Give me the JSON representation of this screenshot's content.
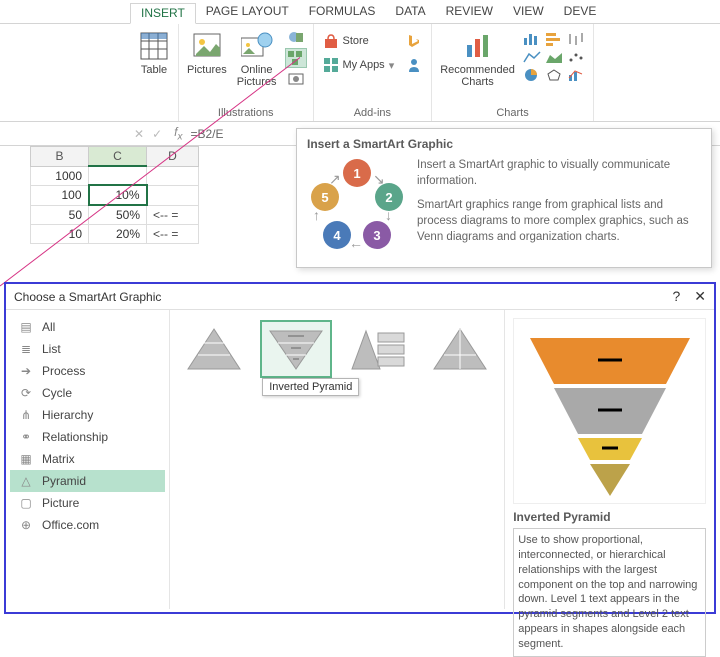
{
  "ribbon": {
    "tabs": [
      "INSERT",
      "PAGE LAYOUT",
      "FORMULAS",
      "DATA",
      "REVIEW",
      "VIEW",
      "DEVE"
    ],
    "active_tab": "INSERT",
    "tables": {
      "table_label": "Table",
      "group_label": ""
    },
    "illustrations": {
      "pictures_label": "Pictures",
      "online_pictures_label": "Online\nPictures",
      "group_label": "Illustrations"
    },
    "addins": {
      "store_label": "Store",
      "myapps_label": "My Apps",
      "group_label": "Add-ins"
    },
    "charts": {
      "recommended_label": "Recommended\nCharts",
      "group_label": "Charts"
    }
  },
  "formula_bar": {
    "formula": "=B2/E"
  },
  "sheet": {
    "cols": [
      "B",
      "C",
      "D"
    ],
    "selected_col": "C",
    "rows": [
      {
        "b": "1000",
        "c": "",
        "d": ""
      },
      {
        "b": "100",
        "c": "10%",
        "d": "",
        "selected": true
      },
      {
        "b": "50",
        "c": "50%",
        "d": "<--  ="
      },
      {
        "b": "10",
        "c": "20%",
        "d": "<--  ="
      }
    ]
  },
  "smartart_tip": {
    "title": "Insert a SmartArt Graphic",
    "p1": "Insert a SmartArt graphic to visually communicate information.",
    "p2": "SmartArt graphics range from graphical lists and process diagrams to more complex graphics, such as Venn diagrams and organization charts."
  },
  "dialog": {
    "title": "Choose a SmartArt Graphic",
    "help": "?",
    "close": "✕",
    "categories": [
      "All",
      "List",
      "Process",
      "Cycle",
      "Hierarchy",
      "Relationship",
      "Matrix",
      "Pyramid",
      "Picture",
      "Office.com"
    ],
    "selected_category": "Pyramid",
    "tooltip": "Inverted Pyramid",
    "preview": {
      "title": "Inverted Pyramid",
      "desc": "Use to show proportional, interconnected, or hierarchical relationships with the largest component on the top and narrowing down. Level 1 text appears in the pyramid segments and Level 2 text appears in shapes alongside each segment."
    }
  }
}
